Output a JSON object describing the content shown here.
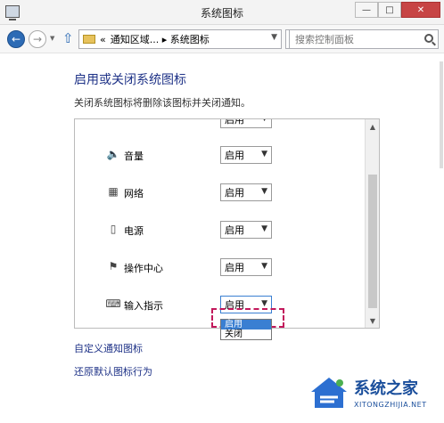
{
  "window": {
    "title": "系统图标",
    "buttons": {
      "minimize": "—",
      "maximize": "□",
      "close": "✕"
    }
  },
  "nav": {
    "back_icon": "arrow-left",
    "forward_icon": "arrow-right",
    "up_icon": "arrow-up",
    "address": "通知区域... ▸ 系统图标",
    "address_prefix": "«",
    "search_placeholder": "搜索控制面板",
    "refresh_icon": "refresh"
  },
  "content": {
    "heading": "启用或关闭系统图标",
    "description": "关闭系统图标将删除该图标并关闭通知。",
    "rows": [
      {
        "label": "",
        "value": "启用",
        "icon": "clock-icon"
      },
      {
        "label": "音量",
        "value": "启用",
        "icon": "speaker-icon"
      },
      {
        "label": "网络",
        "value": "启用",
        "icon": "network-icon"
      },
      {
        "label": "电源",
        "value": "启用",
        "icon": "power-icon"
      },
      {
        "label": "操作中心",
        "value": "启用",
        "icon": "flag-icon"
      },
      {
        "label": "输入指示",
        "value": "启用",
        "icon": "keyboard-icon"
      }
    ],
    "dropdown_options": [
      "启用",
      "关闭"
    ],
    "links": [
      "自定义通知图标",
      "还原默认图标行为"
    ]
  },
  "watermark": {
    "text": "系统之家",
    "domain": "XITONGZHIJIA.NET"
  },
  "colors": {
    "heading": "#1e3287",
    "accent": "#3a7fd2",
    "highlight": "#c2185b"
  }
}
